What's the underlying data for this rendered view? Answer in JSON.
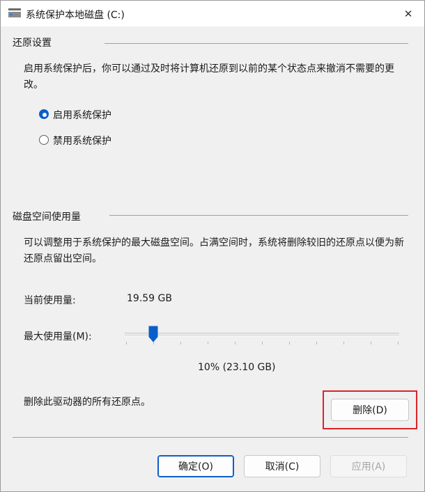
{
  "window": {
    "title": "系统保护本地磁盘 (C:)",
    "close_glyph": "✕"
  },
  "restore_settings": {
    "group_label": "还原设置",
    "description": "启用系统保护后，你可以通过及时将计算机还原到以前的某个状态点来撤消不需要的更改。",
    "options": [
      {
        "label": "启用系统保护",
        "selected": true
      },
      {
        "label": "禁用系统保护",
        "selected": false
      }
    ]
  },
  "disk_usage": {
    "group_label": "磁盘空间使用量",
    "description": "可以调整用于系统保护的最大磁盘空间。占满空间时，系统将删除较旧的还原点以便为新还原点留出空间。",
    "current_label": "当前使用量:",
    "current_value": "19.59 GB",
    "max_label": "最大使用量(M):",
    "slider_percent": 10,
    "slider_readout": "10% (23.10 GB)",
    "delete_text": "删除此驱动器的所有还原点。",
    "delete_button": "删除(D)"
  },
  "footer": {
    "ok": "确定(O)",
    "cancel": "取消(C)",
    "apply": "应用(A)"
  },
  "colors": {
    "accent": "#0a5ec9",
    "highlight_box": "#d9242a"
  }
}
